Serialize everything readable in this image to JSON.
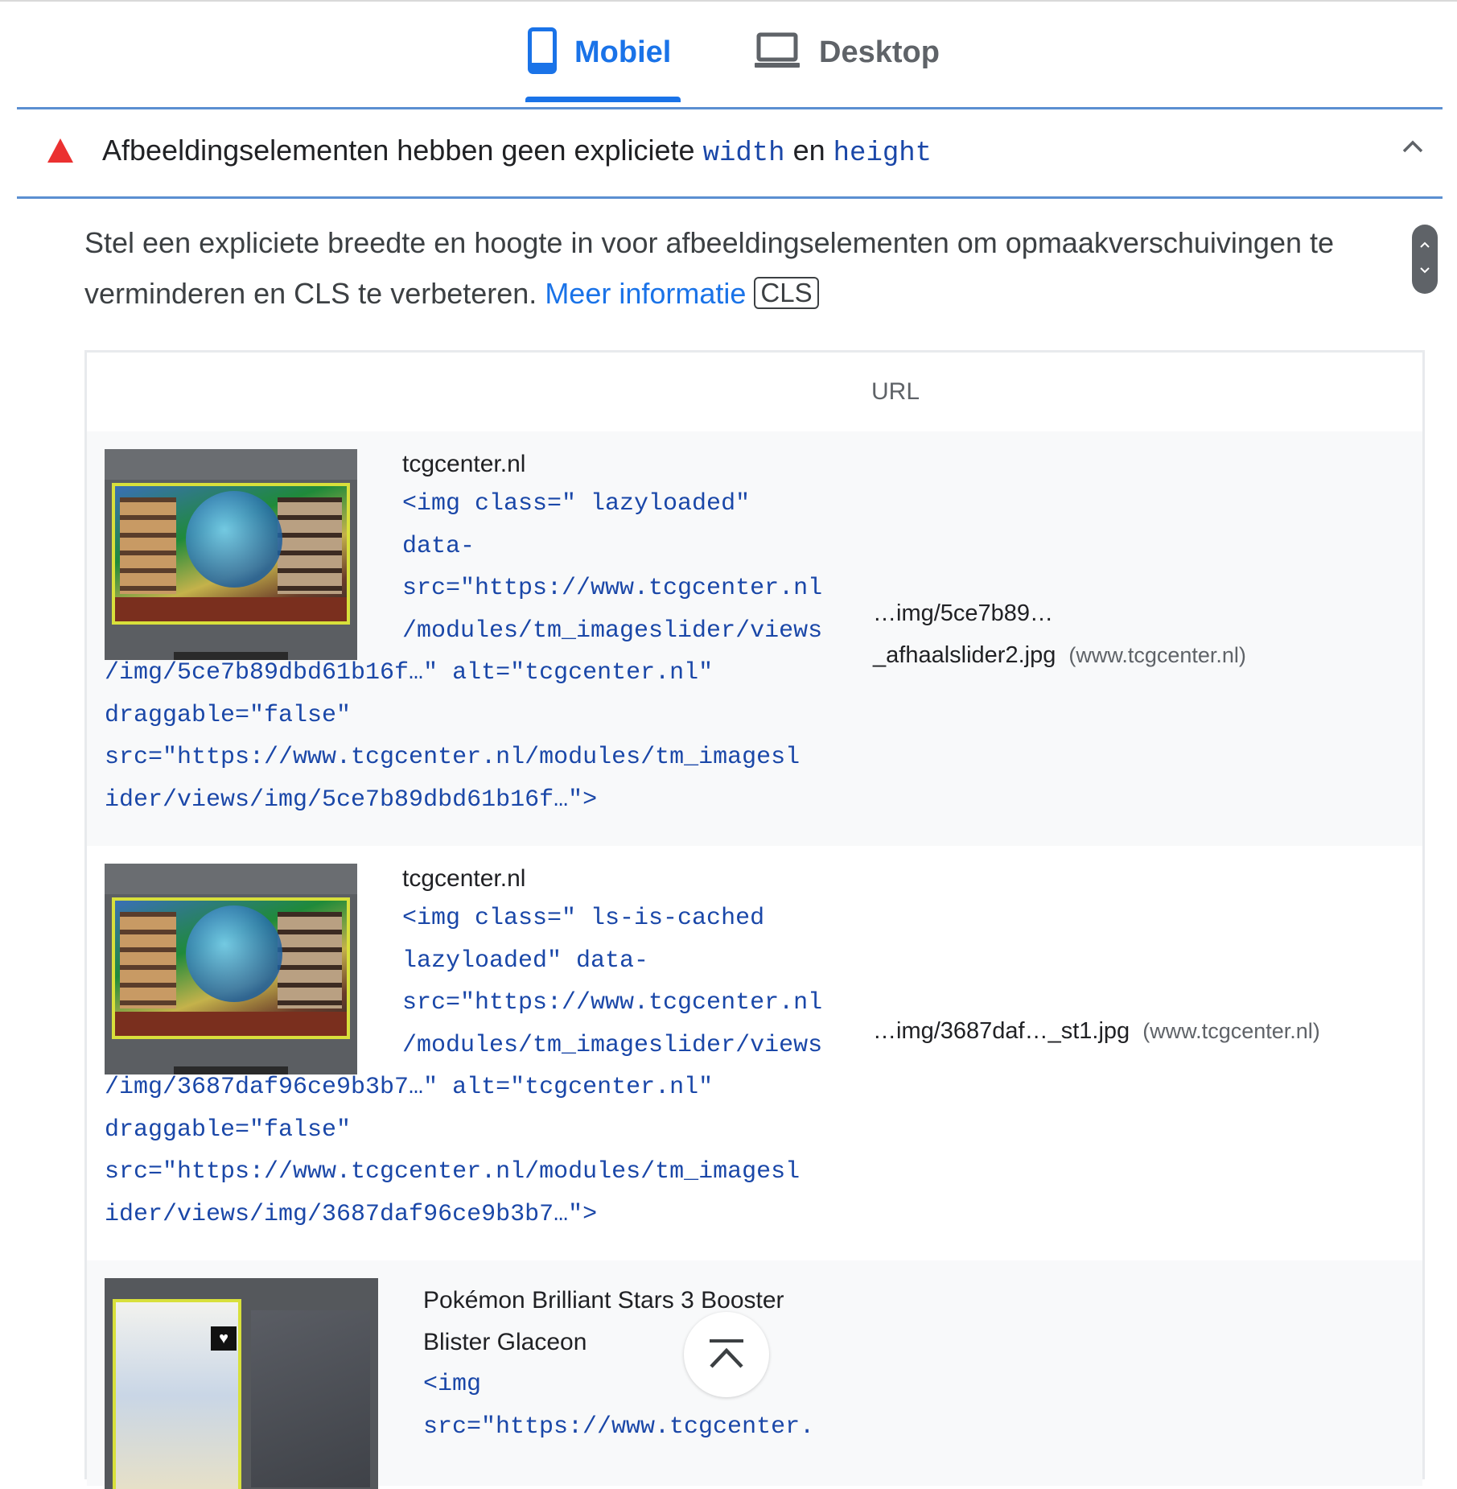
{
  "tabs": [
    {
      "label": "Mobiel",
      "icon": "phone-icon",
      "active": true
    },
    {
      "label": "Desktop",
      "icon": "laptop-icon",
      "active": false
    }
  ],
  "audit": {
    "title_prefix": "Afbeeldingselementen hebben geen expliciete ",
    "code_width": "width",
    "title_middle": " en ",
    "code_height": "height",
    "status_icon": "warning-triangle-icon",
    "status_color": "#eb3131",
    "description": "Stel een expliciete breedte en hoogte in voor afbeeldingselementen om opmaakverschuivingen te verminderen en CLS te verbeteren. ",
    "learn_more": "Meer informatie",
    "badge": "CLS"
  },
  "table": {
    "header_url": "URL",
    "rows": [
      {
        "site": "tcgcenter.nl",
        "snippet_indented": "<img class=\" lazyloaded\"\ndata-\nsrc=\"https://www.tcgcenter.nl\n/modules/tm_imageslider/views",
        "snippet_full": "/img/5ce7b89dbd61b16f…\" alt=\"tcgcenter.nl\"\ndraggable=\"false\"\nsrc=\"https://www.tcgcenter.nl/modules/tm_imagesl\nider/views/img/5ce7b89dbd61b16f…\">",
        "url_line1": "…img/5ce7b89…",
        "url_line2": "_afhaalslider2.jpg",
        "host": "(www.tcgcenter.nl)"
      },
      {
        "site": "tcgcenter.nl",
        "snippet_indented": "<img class=\" ls-is-cached\nlazyloaded\" data-\nsrc=\"https://www.tcgcenter.nl\n/modules/tm_imageslider/views",
        "snippet_full": "/img/3687daf96ce9b3b7…\" alt=\"tcgcenter.nl\"\ndraggable=\"false\"\nsrc=\"https://www.tcgcenter.nl/modules/tm_imagesl\nider/views/img/3687daf96ce9b3b7…\">",
        "url_line1": "…img/3687daf…_st1.jpg",
        "host": "(www.tcgcenter.nl)"
      },
      {
        "site_line1": "Pokémon Brilliant Stars 3 Booster",
        "site_line2": "Blister Glaceon",
        "snippet_indented": "<img\nsrc=\"https://www.tcgcenter."
      }
    ]
  },
  "back_to_top_icon": "chevron-up-bar-icon"
}
